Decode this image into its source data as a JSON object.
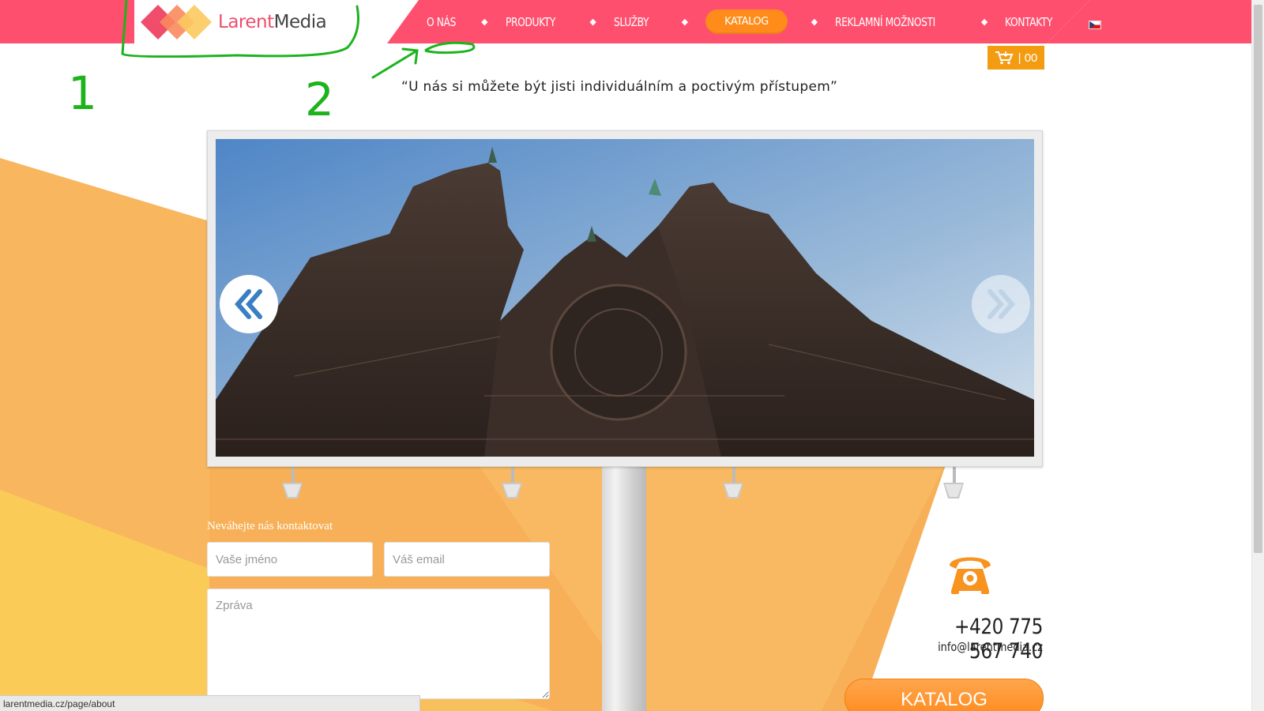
{
  "brand": {
    "logo_part1": "Larent",
    "logo_part2": "Media"
  },
  "nav": {
    "items": [
      "O NÁS",
      "PRODUKTY",
      "SLUŽBY",
      "KATALOG",
      "REKLAMNÍ MOŽNOSTI",
      "KONTAKTY"
    ],
    "separator": "◆",
    "active": "KATALOG"
  },
  "language_flag": "flag-cz-icon",
  "cart": {
    "icon": "cart-icon",
    "label": "| 00"
  },
  "tagline": "“U nás si můžete být jisti individuálním a poctivým přístupem”",
  "slider": {
    "prev_icon": "double-chevron-left-icon",
    "next_icon": "double-chevron-right-icon"
  },
  "contact": {
    "title": "Neváhejte nás kontaktovat",
    "name_placeholder": "Vaše jméno",
    "email_placeholder": "Váš email",
    "message_placeholder": "Zpráva"
  },
  "phone": {
    "icon": "phone-icon",
    "number": "+420 775 567 740",
    "email": "info@larentmedia.cz"
  },
  "catalog_button": "KATALOG",
  "status_bar": "larentmedia.cz/page/about",
  "annotations": [
    "1",
    "2"
  ],
  "colors": {
    "header_pink": "#ff4f6e",
    "accent_orange": "#ff8c1a",
    "background_orange": "#f7b259",
    "annotation_green": "#1db31d"
  }
}
